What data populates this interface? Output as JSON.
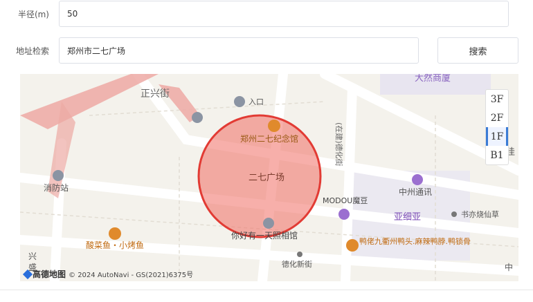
{
  "form": {
    "radius_label": "半径(m)",
    "radius_value": "50",
    "address_label": "地址检索",
    "address_value": "郑州市二七广场",
    "search_button": "搜索"
  },
  "map": {
    "circle_label": "二七广场",
    "labels": {
      "street_zhengxing": "正兴街",
      "entrance": "入口",
      "memorial": "郑州二七纪念馆",
      "fire_station": "消防站",
      "under_construction": "(在建)德化街",
      "zhongzhou": "中州通讯",
      "modou": "MODOU魔豆",
      "yaxiya": "亚细亚",
      "shuyi": "书亦烧仙草",
      "duck": "鸭佬九衢州鸭头.麻辣鸭脖.鸭锁骨",
      "photo": "你好有一天照相馆",
      "fish": "酸菜鱼・小烤鱼",
      "dehua_new": "德化新街",
      "daran": "大然商厦",
      "jia": "佳",
      "zhong": "中",
      "xing": "兴",
      "sheng": "盛"
    },
    "floors": [
      "3F",
      "2F",
      "1F",
      "B1"
    ],
    "active_floor": "1F",
    "copyright": "© 2024 AutoNavi - GS(2021)6375号",
    "logo_text": "高德地图"
  }
}
